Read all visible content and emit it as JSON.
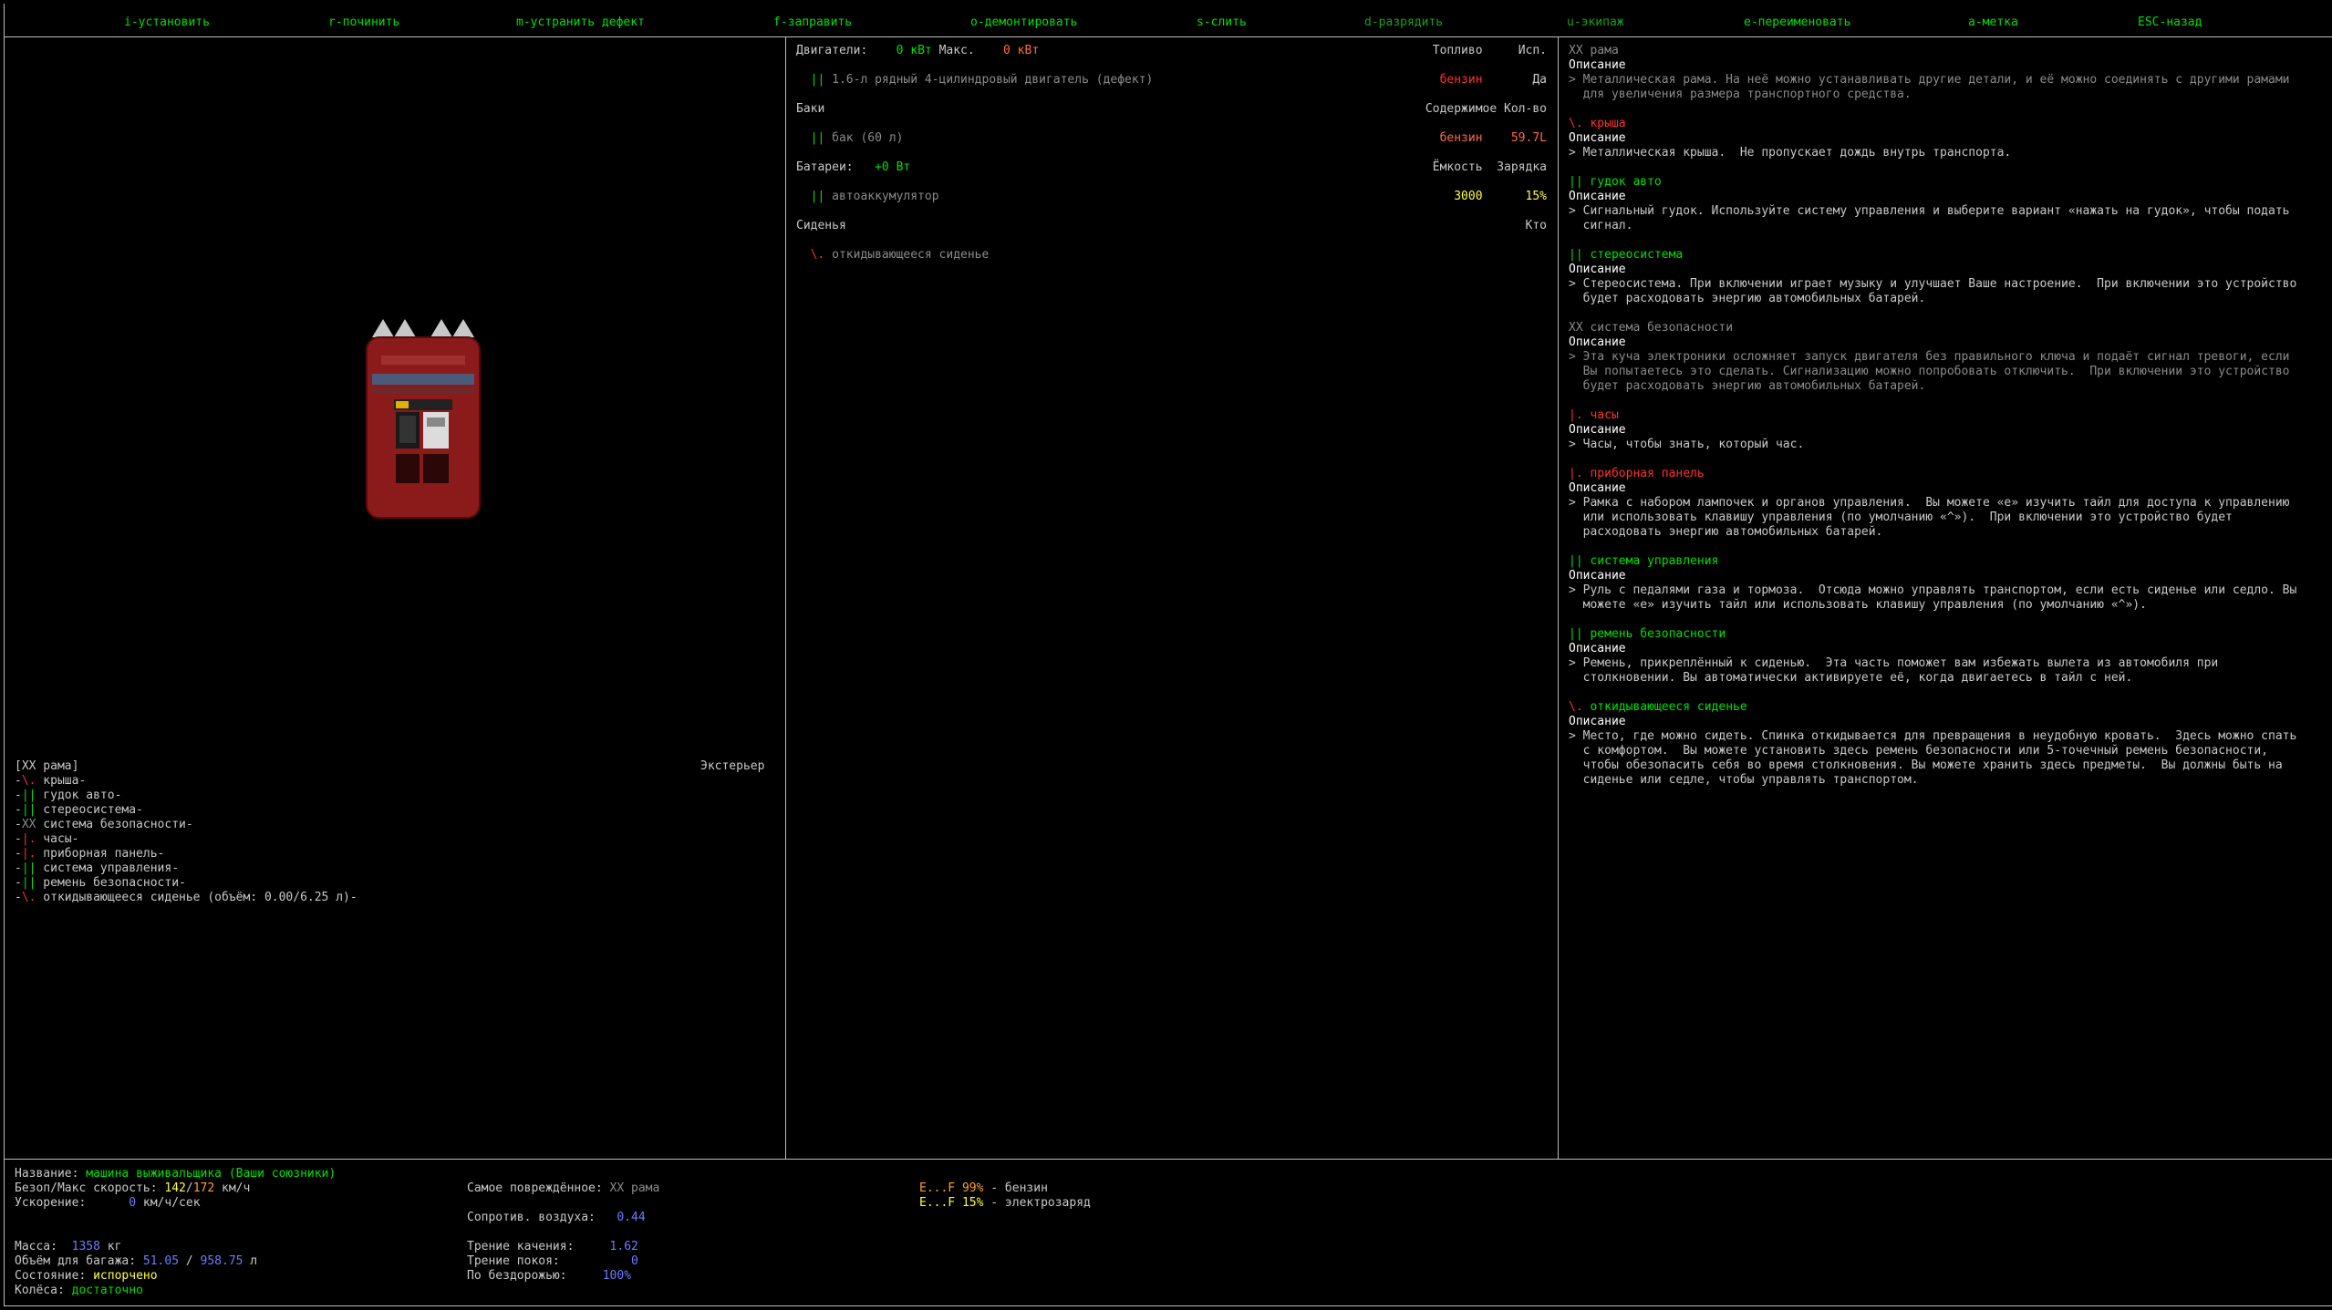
{
  "keybar": [
    {
      "key": "i",
      "sep": "-",
      "label": "установить",
      "kc": "grn",
      "lc": "grn"
    },
    {
      "key": "r",
      "sep": "-",
      "label": "починить",
      "kc": "grn",
      "lc": "grn"
    },
    {
      "key": "m",
      "sep": "-",
      "label": "устранить дефект",
      "kc": "grn",
      "lc": "grn"
    },
    {
      "key": "f",
      "sep": "-",
      "label": "заправить",
      "kc": "grn",
      "lc": "grn"
    },
    {
      "key": "o",
      "sep": "-",
      "label": "демонтировать",
      "kc": "grn",
      "lc": "grn"
    },
    {
      "key": "s",
      "sep": "-",
      "label": "слить",
      "kc": "grn",
      "lc": "grn"
    },
    {
      "key": "d",
      "sep": "-",
      "label": "разрядить",
      "kc": "dgrn",
      "lc": "dgrn"
    },
    {
      "key": "u",
      "sep": "-",
      "label": "экипаж",
      "kc": "dgrn",
      "lc": "dgrn"
    },
    {
      "key": "e",
      "sep": "-",
      "label": "переименовать",
      "kc": "grn",
      "lc": "grn"
    },
    {
      "key": "a",
      "sep": "-",
      "label": "метка",
      "kc": "grn",
      "lc": "grn"
    },
    {
      "key": "ESC",
      "sep": "-",
      "label": "назад",
      "kc": "grn",
      "lc": "grn"
    }
  ],
  "left": {
    "parts_header": "[XX рама]",
    "exterior_label": "Экстерьер",
    "parts": [
      {
        "prefix": "-",
        "sym": "\\.",
        "sc": "red",
        "name": " крыша-"
      },
      {
        "prefix": "-",
        "sym": "||",
        "sc": "grn",
        "name": " гудок авто-"
      },
      {
        "prefix": "-",
        "sym": "||",
        "sc": "grn",
        "name": " стереосистема-"
      },
      {
        "prefix": "-",
        "sym": "XX",
        "sc": "gry",
        "name": " система безопасности-"
      },
      {
        "prefix": "-",
        "sym": "|.",
        "sc": "red",
        "name": " часы-"
      },
      {
        "prefix": "-",
        "sym": "|.",
        "sc": "red",
        "name": " приборная панель-"
      },
      {
        "prefix": "-",
        "sym": "||",
        "sc": "grn",
        "name": " система управления-"
      },
      {
        "prefix": "-",
        "sym": "||",
        "sc": "grn",
        "name": " ремень безопасности-"
      },
      {
        "prefix": "-",
        "sym": "\\.",
        "sc": "red",
        "name": " откидывающееся сиденье (объём: 0.00/6.25 л)-"
      }
    ]
  },
  "middle": {
    "engines": {
      "title": "Двигатели:",
      "power": "0 кВт",
      "max_label": "Макс.",
      "max": "0 кВт",
      "col1": "Топливо",
      "col2": "Исп.",
      "item": {
        "sym": "||",
        "name": "1.6-л рядный 4-цилиндровый двигатель (дефект)",
        "fuel": "бензин",
        "use": "Да"
      }
    },
    "tanks": {
      "title": "Баки",
      "col1": "Содержимое",
      "col2": "Кол-во",
      "item": {
        "sym": "||",
        "name": "бак (60 л)",
        "content": "бензин",
        "amount": "59.7L"
      }
    },
    "batteries": {
      "title": "Батареи:",
      "power": "+0 Вт",
      "col1": "Ёмкость",
      "col2": "Зарядка",
      "item": {
        "sym": "||",
        "name": "автоаккумулятор",
        "capacity": "3000",
        "charge": "15%"
      }
    },
    "seats": {
      "title": "Сиденья",
      "col1": "Кто",
      "item": {
        "sym": "\\.",
        "name": "откидывающееся сиденье"
      }
    }
  },
  "right": {
    "desc_label": "Описание",
    "items": [
      {
        "sym": "XX",
        "name": "рама",
        "nc": "gry",
        "desc": "> Металлическая рама. На неё можно устанавливать другие детали, и её можно соединять с другими рамами\n  для увеличения размера транспортного средства.",
        "dc": "gry"
      },
      {
        "sym": "\\.",
        "name": "крыша",
        "nc": "red",
        "sc": "red",
        "desc": "> Металлическая крыша.  Не пропускает дождь внутрь транспорта.",
        "dc": "lgr"
      },
      {
        "sym": "||",
        "name": "гудок авто",
        "nc": "grn",
        "sc": "grn",
        "desc": "> Сигнальный гудок. Используйте систему управления и выберите вариант «нажать на гудок», чтобы подать\n  сигнал.",
        "dc": "lgr"
      },
      {
        "sym": "||",
        "name": "стереосистема",
        "nc": "grn",
        "sc": "grn",
        "desc": "> Стереосистема. При включении играет музыку и улучшает Ваше настроение.  При включении это устройство\n  будет расходовать энергию автомобильных батарей.",
        "dc": "lgr"
      },
      {
        "sym": "XX",
        "name": "система безопасности",
        "nc": "gry",
        "sc": "gry",
        "desc": "> Эта куча электроники осложняет запуск двигателя без правильного ключа и подаёт сигнал тревоги, если\n  Вы попытаетесь это сделать. Сигнализацию можно попробовать отключить.  При включении это устройство\n  будет расходовать энергию автомобильных батарей.",
        "dc": "gry"
      },
      {
        "sym": "|.",
        "name": "часы",
        "nc": "red",
        "sc": "red",
        "desc": "> Часы, чтобы знать, который час.",
        "dc": "lgr"
      },
      {
        "sym": "|.",
        "name": "приборная панель",
        "nc": "red",
        "sc": "red",
        "desc": "> Рамка с набором лампочек и органов управления.  Вы можете «e» изучить тайл для доступа к управлению\n  или использовать клавишу управления (по умолчанию «^»).  При включении это устройство будет\n  расходовать энергию автомобильных батарей.",
        "dc": "lgr"
      },
      {
        "sym": "||",
        "name": "система управления",
        "nc": "grn",
        "sc": "grn",
        "desc": "> Руль с педалями газа и тормоза.  Отсюда можно управлять транспортом, если есть сиденье или седло. Вы\n  можете «e» изучить тайл или использовать клавишу управления (по умолчанию «^»).",
        "dc": "lgr"
      },
      {
        "sym": "||",
        "name": "ремень безопасности",
        "nc": "grn",
        "sc": "grn",
        "desc": "> Ремень, прикреплённый к сиденью.  Эта часть поможет вам избежать вылета из автомобиля при\n  столкновении. Вы автоматически активируете её, когда двигаетесь в тайл с ней.",
        "dc": "lgr"
      },
      {
        "sym": "\\.",
        "name": "откидывающееся сиденье",
        "nc": "grn",
        "sc": "red",
        "desc": "> Место, где можно сидеть. Спинка откидывается для превращения в неудобную кровать.  Здесь можно спать\n  с комфортом.  Вы можете установить здесь ремень безопасности или 5-точечный ремень безопасности,\n  чтобы обезопасить себя во время столкновения. Вы можете хранить здесь предметы.  Вы должны быть на\n  сиденье или седле, чтобы управлять транспортом.",
        "dc": "lgr"
      }
    ]
  },
  "bottom": {
    "name_label": "Название:",
    "name": "машина выживальщика (Ваши союзники)",
    "speed_label": "Безоп/Макс скорость:",
    "safe_speed": "142",
    "speed_sep": "/",
    "max_speed": "172",
    "speed_unit": " км/ч",
    "accel_label": "Ускорение:",
    "accel": "0",
    "accel_unit": " км/ч/сек",
    "mass_label": "Масса:",
    "mass": "1358",
    "mass_unit": " кг",
    "cargo_label": "Объём для багажа:",
    "cargo_used": "51.05",
    "cargo_sep": " / ",
    "cargo_total": "958.75",
    "cargo_unit": " л",
    "state_label": "Состояние:",
    "state": "испорчено",
    "wheels_label": "Колёса:",
    "wheels": "достаточно",
    "damaged_label": "Самое повреждённое:",
    "damaged": "XX рама",
    "air_label": "Сопротив. воздуха:",
    "air": "0.44",
    "roll_label": "Трение качения:",
    "roll": "1.62",
    "static_label": "Трение покоя:",
    "static": "0",
    "offroad_label": "По бездорожью:",
    "offroad": "100%",
    "fuel": [
      {
        "gauge_e": "E...F",
        "pct": "99%",
        "label": " - бензин",
        "gc": "org"
      },
      {
        "gauge_e": "E...F",
        "pct": "15%",
        "label": " - электрозаряд",
        "gc": "yel"
      }
    ]
  },
  "colors": {
    "border": "#bdbdbd",
    "green": "#00e000",
    "red": "#ff3030",
    "yellow": "#ffff40",
    "blue": "#6e7bff",
    "vehicle_body": "#8b1a1a"
  }
}
